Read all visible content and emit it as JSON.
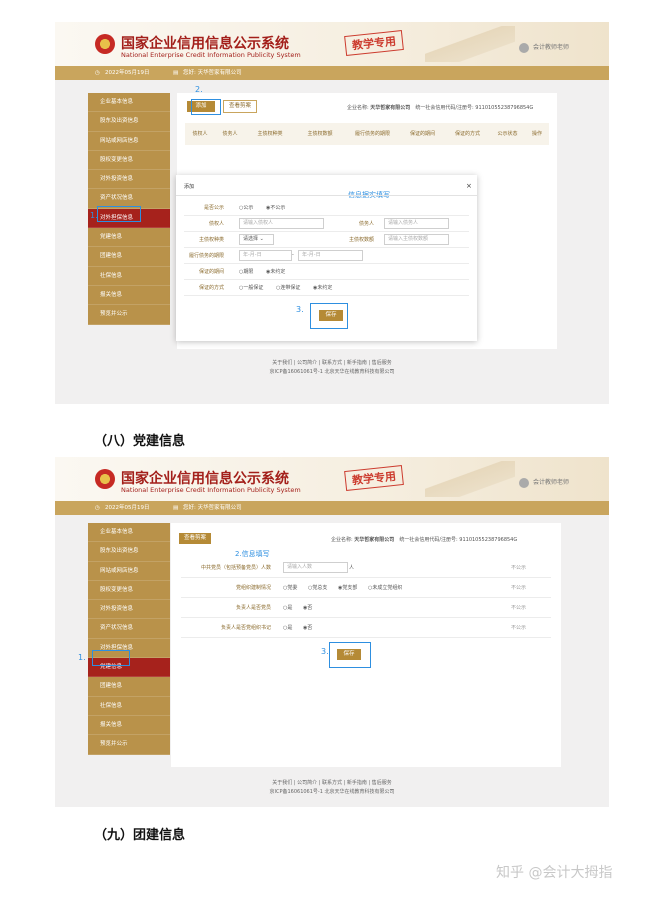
{
  "header": {
    "title_cn": "国家企业信用信息公示系统",
    "title_en": "National Enterprise Credit Information Publicity System",
    "stamp": "教学专用",
    "user": "会计教师老师"
  },
  "bar": {
    "date": "2022年05月19日",
    "notice": "您好: 天华哲家有限公司"
  },
  "sidebar": [
    "企业基本信息",
    "股东及出资信息",
    "网站或网店信息",
    "股权变更信息",
    "对外投资信息",
    "资产状况信息",
    "对外担保信息",
    "党建信息",
    "团建信息",
    "社保信息",
    "报关信息",
    "预览并公示"
  ],
  "shot1": {
    "add_button": "添加",
    "view_button": "查看剪案",
    "company_label": "企业名称:",
    "company_name": "天华哲家有限公司",
    "credit_label": "统一社会信用代码/注册号:",
    "credit_code": "91101055238796854G",
    "columns": [
      "债权人",
      "债务人",
      "主债权种类",
      "主债权数额",
      "履行债务的期限",
      "保证的期间",
      "保证的方式",
      "公示状态",
      "操作"
    ],
    "modal": {
      "title": "添加",
      "note": "信息据实填写",
      "close": "×",
      "public_label": "是否公示",
      "public_yes": "公示",
      "public_no": "不公示",
      "creditor_label": "债权人",
      "creditor_ph": "请输入债权人",
      "debtor_label": "债务人",
      "debtor_ph": "请输入债务人",
      "kind_label": "主债权种类",
      "kind_value": "请选择",
      "amount_label": "主债权数额",
      "amount_ph": "请输入主债权数额",
      "term_label": "履行债务的期限",
      "date_from": "年-月-日",
      "date_to": "年-月-日",
      "period_label": "保证的期间",
      "period_a": "期限",
      "period_b": "未约定",
      "method_label": "保证的方式",
      "method_a": "一般保证",
      "method_b": "连带保证",
      "method_c": "未约定",
      "save": "保存"
    },
    "footer_links": "关于我们 | 公司简介 | 联系方式 | 新手指南 | 售后服务",
    "footer_icp": "京ICP备16061061号-1 北京天华在线教育科技有限公司"
  },
  "shot2": {
    "view_button": "查看剪案",
    "company_label": "企业名称:",
    "company_name": "天华哲家有限公司",
    "credit_label": "统一社会信用代码/注册号:",
    "credit_code": "91101055238796854G",
    "note": "2.信息填写",
    "rows": [
      {
        "label": "中共党员（包括预备党员）人数",
        "value": "请输入人数",
        "unit": "人",
        "status": "不公示"
      },
      {
        "label": "党组织建制情况",
        "options": [
          "党委",
          "党总支",
          "党支部",
          "未成立党组织"
        ],
        "status": "不公示"
      },
      {
        "label": "负责人是否党员",
        "options": [
          "是",
          "否"
        ],
        "status": "不公示"
      },
      {
        "label": "负责人是否党组织书记",
        "options": [
          "是",
          "否"
        ],
        "status": "不公示"
      }
    ],
    "save": "保存",
    "footer_links": "关于我们 | 公司简介 | 联系方式 | 新手指南 | 售后服务",
    "footer_icp": "京ICP备16061061号-1 北京天华在线教育科技有限公司"
  },
  "steps": {
    "s1": "1.",
    "s2": "2.",
    "s3": "3."
  },
  "heading_8": "（八）党建信息",
  "heading_9": "（九）团建信息",
  "watermark": "知乎 @会计大拇指"
}
